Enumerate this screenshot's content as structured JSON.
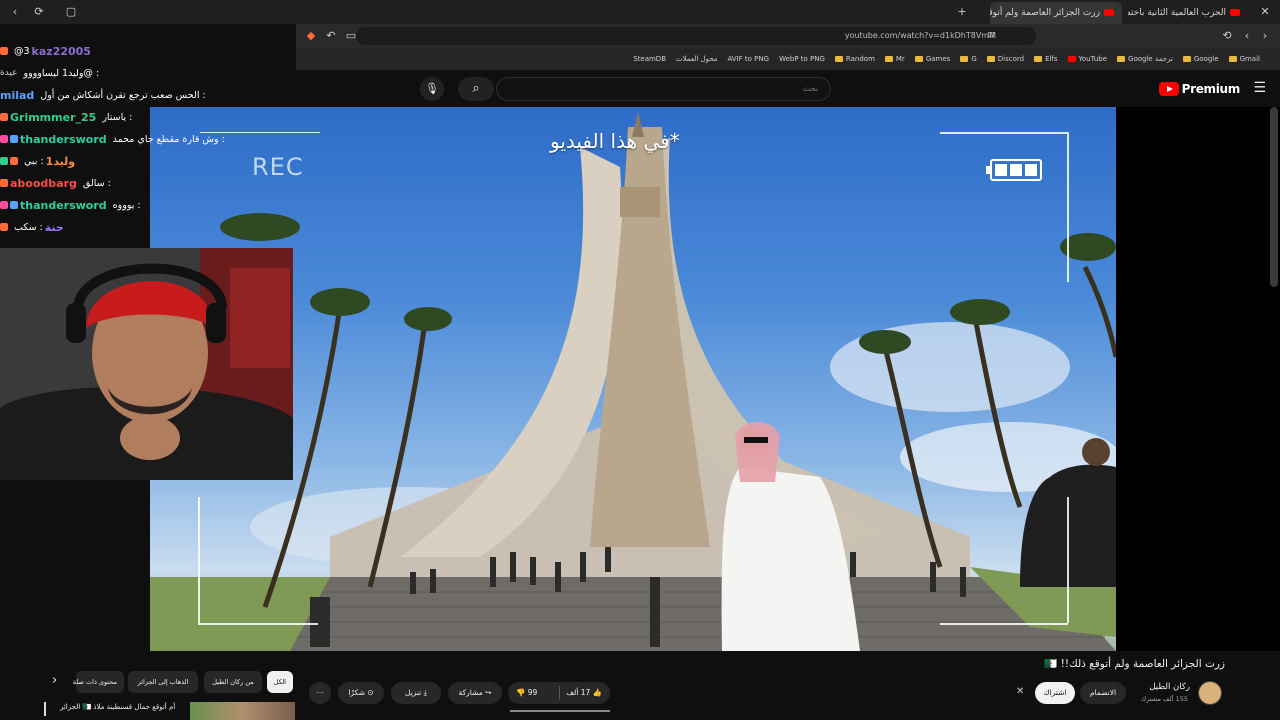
{
  "browser": {
    "tabs": [
      {
        "title": "زرت الجزائر العاصمة ولم أتوقع ذلك!!",
        "active": true
      },
      {
        "title": "الحرب العالمية الثانية باختصار - YouTube",
        "active": false
      }
    ],
    "url": "youtube.com/watch?v=d1kDhT8VmM",
    "bookmarks": [
      "SteamDB",
      "محول العملات",
      "AVIF to PNG",
      "WebP to PNG",
      "Random",
      "Mr",
      "Games",
      "G",
      "Discord",
      "Elfs",
      "YouTube",
      "Google ترجمة",
      "Google",
      "Gmail"
    ]
  },
  "masthead": {
    "search_placeholder": "بحث",
    "logo_text": "Premium"
  },
  "chat": [
    {
      "user": "kaz22005",
      "msg": "3@",
      "color": "#8a6fd0"
    },
    {
      "user": "عيدة",
      "msg": ": @وليد1 ليساوووو",
      "color": "#d0d0d0"
    },
    {
      "user": "milad",
      "msg": ": الحس صعب ترجع تقرن أشكاش من أول",
      "color": "#5aa0ff"
    },
    {
      "user": "Grimmmer_25",
      "msg": ": ياستار",
      "color": "#2fd08a"
    },
    {
      "user": "thandersword",
      "msg": ": وش قارة مقطع جاي محمد",
      "color": "#2fd0a0"
    },
    {
      "user": "وليد1",
      "msg": ": ببي",
      "color": "#ff8a3a"
    },
    {
      "user": "aboodbarg",
      "msg": ": سالق",
      "color": "#ff4a4a"
    },
    {
      "user": "thandersword",
      "msg": ": يوووه",
      "color": "#2fd0a0"
    },
    {
      "user": "حنة",
      "msg": ": سكب",
      "color": "#a070ff"
    }
  ],
  "video": {
    "caption": "*في هذا الفيديو",
    "rec_label": "REC"
  },
  "details": {
    "title": "زرت الجزائر العاصمة ولم أتوقع ذلك!! 🇩🇿",
    "channel": "ركان الطيل",
    "subscribers": "155 ألف مشترك",
    "join_label": "الانضمام",
    "subscribe_label": "اشتراك",
    "likes": "17 ألف",
    "dislikes": "99",
    "share_label": "مشاركة",
    "download_label": "تنزيل",
    "thanks_label": "شكرًا"
  },
  "chips": [
    "الكل",
    "من ركان الطيل",
    "الذهاب إلى الجزائر",
    "محتوى ذات صلة"
  ],
  "suggestion": {
    "title": "أم أتوقع جمال قسنطينة ملاذ 🇩🇿 الجزائر"
  }
}
